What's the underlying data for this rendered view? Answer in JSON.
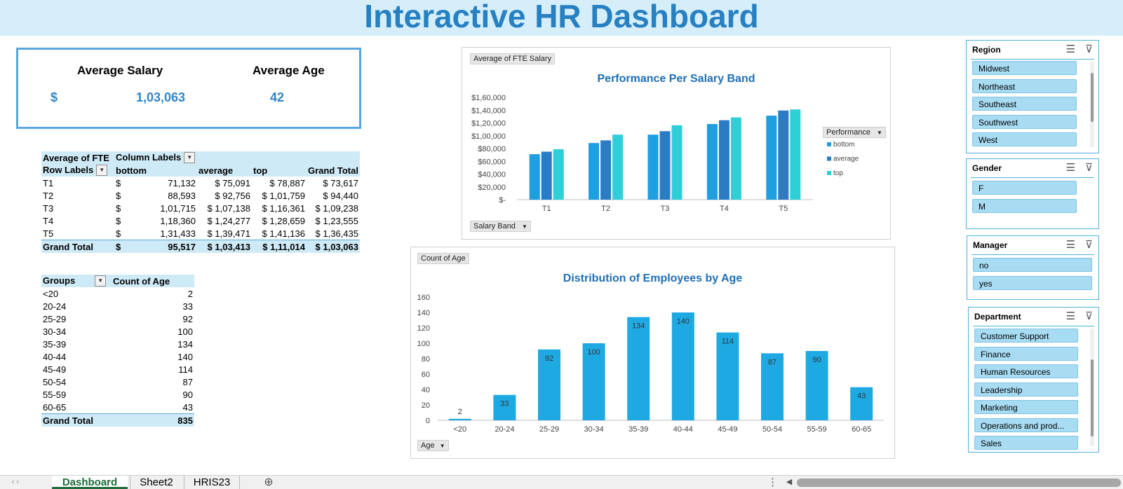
{
  "title": "Interactive HR Dashboard",
  "kpi": {
    "salary_label": "Average Salary",
    "salary_currency": "$",
    "salary_value": "1,03,063",
    "age_label": "Average Age",
    "age_value": "42"
  },
  "salary_pivot": {
    "corner_label": "Average of FTE",
    "column_labels": "Column Labels",
    "row_labels": "Row Labels",
    "headers": [
      "bottom",
      "average",
      "top",
      "Grand Total"
    ],
    "rows": [
      {
        "label": "T1",
        "cur": "$",
        "bottom": "71,132",
        "average": "$   75,091",
        "top": "$   78,887",
        "total": "$   73,617"
      },
      {
        "label": "T2",
        "cur": "$",
        "bottom": "88,593",
        "average": "$   92,756",
        "top": "$ 1,01,759",
        "total": "$   94,440"
      },
      {
        "label": "T3",
        "cur": "$",
        "bottom": "1,01,715",
        "average": "$ 1,07,138",
        "top": "$ 1,16,361",
        "total": "$ 1,09,238"
      },
      {
        "label": "T4",
        "cur": "$",
        "bottom": "1,18,360",
        "average": "$ 1,24,277",
        "top": "$ 1,28,659",
        "total": "$ 1,23,555"
      },
      {
        "label": "T5",
        "cur": "$",
        "bottom": "1,31,433",
        "average": "$ 1,39,471",
        "top": "$ 1,41,136",
        "total": "$ 1,36,435"
      }
    ],
    "grand": {
      "label": "Grand Total",
      "cur": "$",
      "bottom": "95,517",
      "average": "$ 1,03,413",
      "top": "$ 1,11,014",
      "total": "$ 1,03,063"
    }
  },
  "age_pivot": {
    "col1": "Groups",
    "col2": "Count of Age",
    "rows": [
      {
        "group": "<20",
        "count": "2"
      },
      {
        "group": "20-24",
        "count": "33"
      },
      {
        "group": "25-29",
        "count": "92"
      },
      {
        "group": "30-34",
        "count": "100"
      },
      {
        "group": "35-39",
        "count": "134"
      },
      {
        "group": "40-44",
        "count": "140"
      },
      {
        "group": "45-49",
        "count": "114"
      },
      {
        "group": "50-54",
        "count": "87"
      },
      {
        "group": "55-59",
        "count": "90"
      },
      {
        "group": "60-65",
        "count": "43"
      }
    ],
    "grand_label": "Grand Total",
    "grand_value": "835"
  },
  "chart_data": [
    {
      "type": "bar",
      "title": "Performance Per Salary Band",
      "field_button": "Average of FTE Salary",
      "axis_button": "Salary Band",
      "legend_title": "Performance",
      "legend_position": "right",
      "categories": [
        "T1",
        "T2",
        "T3",
        "T4",
        "T5"
      ],
      "series": [
        {
          "name": "bottom",
          "values": [
            71132,
            88593,
            101715,
            118360,
            131433
          ],
          "color": "#1f9ee0"
        },
        {
          "name": "average",
          "values": [
            75091,
            92756,
            107138,
            124277,
            139471
          ],
          "color": "#2a7dc5"
        },
        {
          "name": "top",
          "values": [
            78887,
            101759,
            116361,
            128659,
            141136
          ],
          "color": "#2fcfd8"
        }
      ],
      "y_ticks": [
        "$-",
        "$20,000",
        "$40,000",
        "$60,000",
        "$80,000",
        "$1,00,000",
        "$1,20,000",
        "$1,40,000",
        "$1,60,000"
      ],
      "ylim": [
        0,
        160000
      ],
      "grid": false
    },
    {
      "type": "bar",
      "title": "Distribution of Employees by Age",
      "field_button": "Count of Age",
      "axis_button": "Age",
      "categories": [
        "<20",
        "20-24",
        "25-29",
        "30-34",
        "35-39",
        "40-44",
        "45-49",
        "50-54",
        "55-59",
        "60-65"
      ],
      "values": [
        2,
        33,
        92,
        100,
        134,
        140,
        114,
        87,
        90,
        43
      ],
      "color": "#1fa9e2",
      "y_ticks": [
        "0",
        "20",
        "40",
        "60",
        "80",
        "100",
        "120",
        "140",
        "160"
      ],
      "ylim": [
        0,
        160
      ],
      "grid": false,
      "data_labels": true
    }
  ],
  "slicers": {
    "region": {
      "title": "Region",
      "items": [
        "Midwest",
        "Northeast",
        "Southeast",
        "Southwest",
        "West"
      ]
    },
    "gender": {
      "title": "Gender",
      "items": [
        "F",
        "M"
      ]
    },
    "manager": {
      "title": "Manager",
      "items": [
        "no",
        "yes"
      ]
    },
    "department": {
      "title": "Department",
      "items": [
        "Customer Support",
        "Finance",
        "Human Resources",
        "Leadership",
        "Marketing",
        "Operations and prod...",
        "Sales"
      ]
    }
  },
  "sheet_tabs": [
    "Dashboard",
    "Sheet2",
    "HRIS23"
  ],
  "icons": {
    "multiselect": "multi-select-icon",
    "clear_filter": "clear-filter-icon",
    "add_sheet": "plus-icon"
  }
}
